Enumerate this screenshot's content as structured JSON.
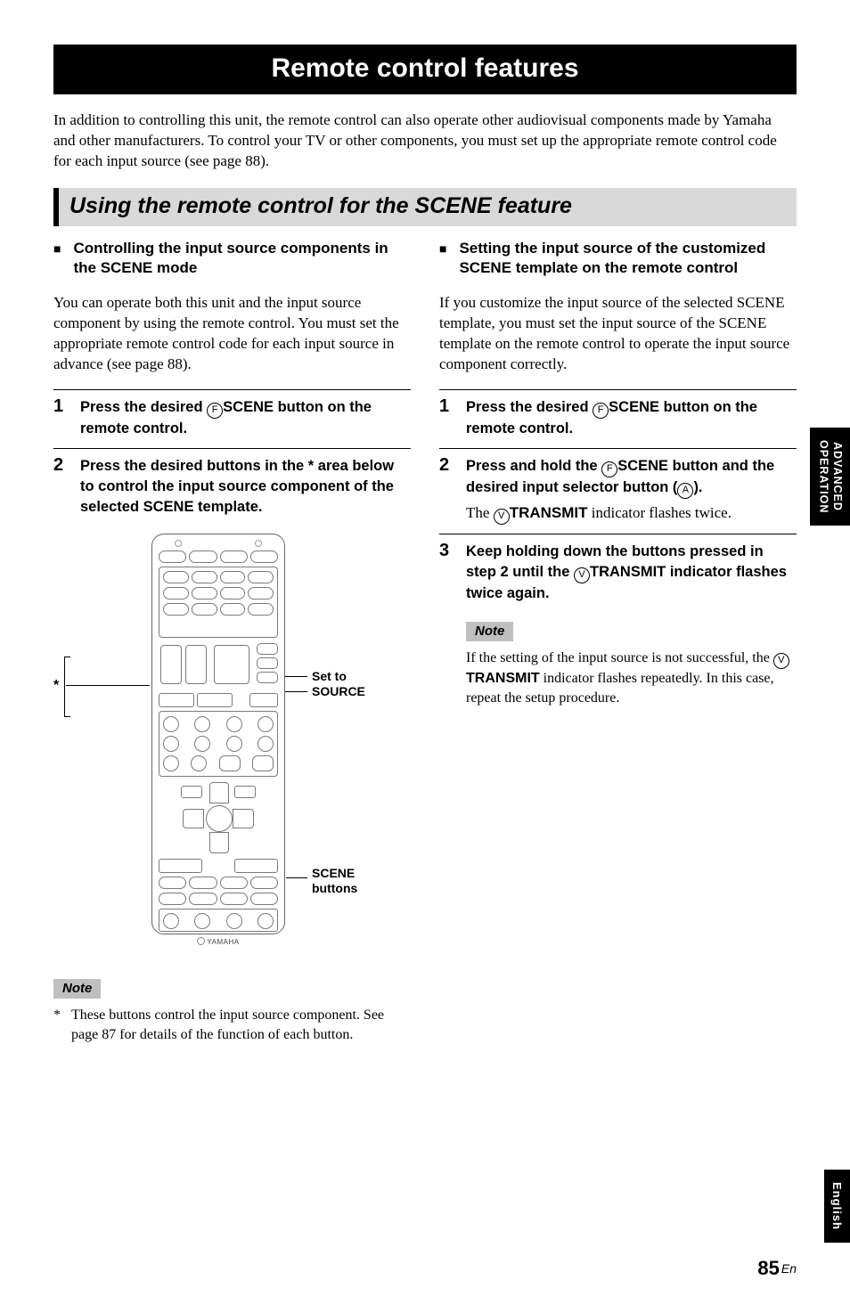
{
  "h1": "Remote control features",
  "intro": "In addition to controlling this unit, the remote control can also operate other audiovisual components made by Yamaha and other manufacturers. To control your TV or other components, you must set up the appropriate remote control code for each input source (see page 88).",
  "h2": "Using the remote control for the SCENE feature",
  "left": {
    "sub": "Controlling the input source components in the SCENE mode",
    "p1": "You can operate both this unit and the input source component by using the remote control. You must set the appropriate remote control code for each input source in advance (see page 88).",
    "s1": "Press the desired ",
    "s1_circle": "F",
    "s1_label": "SCENE",
    "s1_tail": " button on the remote control.",
    "s2": "Press the desired buttons in the * area below to control the input source component of the selected SCENE template.",
    "callout_source": "Set to SOURCE",
    "callout_scene": "SCENE buttons",
    "asterisk": "*",
    "brand": "YAMAHA",
    "note_label": "Note",
    "footnote_mark": "*",
    "footnote": "These buttons control the input source component. See page 87 for details of the function of each button."
  },
  "right": {
    "sub": "Setting the input source of the customized SCENE template on the remote control",
    "p1": "If you customize the input source of the selected SCENE template, you must set the input source of the SCENE template on the remote control to operate the input source component correctly.",
    "s1": "Press the desired ",
    "s1_circle": "F",
    "s1_label": "SCENE",
    "s1_tail": " button on the remote control.",
    "s2a": "Press and hold the ",
    "s2_circle1": "F",
    "s2_label1": "SCENE",
    "s2b": " button and the desired input selector button (",
    "s2_circle2": "A",
    "s2c": ").",
    "s2_plain_a": "The ",
    "s2_plain_circle": "V",
    "s2_plain_label": "TRANSMIT",
    "s2_plain_b": " indicator flashes twice.",
    "s3a": "Keep holding down the buttons pressed in step 2 until the ",
    "s3_circle": "V",
    "s3_label": "TRANSMIT",
    "s3b": " indicator flashes twice again.",
    "note_label": "Note",
    "note_a": "If the setting of the input source is not successful, the ",
    "note_circle": "V",
    "note_labelT": "TRANSMIT",
    "note_b": " indicator flashes repeatedly. In this case, repeat the setup procedure."
  },
  "side_tab_top_l1": "ADVANCED",
  "side_tab_top_l2": "OPERATION",
  "side_tab_bot": "English",
  "page_num": "85",
  "page_lang": "En"
}
